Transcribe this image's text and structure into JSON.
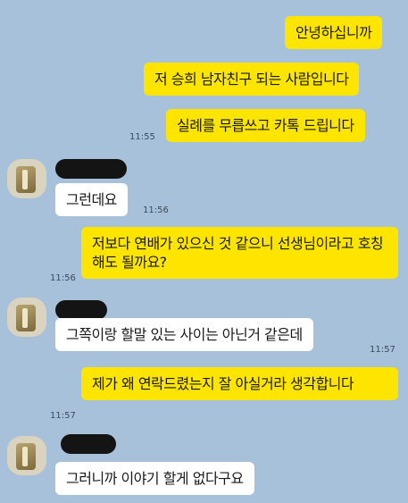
{
  "messages": [
    {
      "from": "me",
      "text": "안녕하십니까"
    },
    {
      "from": "me",
      "text": "저 승희 남자친구 되는 사람입니다"
    },
    {
      "from": "me",
      "text": "실례를 무릅쓰고 카톡 드립니다",
      "time": "11:55"
    },
    {
      "from": "other",
      "text": "그런데요",
      "time": "11:56"
    },
    {
      "from": "me",
      "text": "저보다 연배가 있으신 것 같으니 선생님이라고 호칭해도 될까요?",
      "time": "11:56"
    },
    {
      "from": "other",
      "text": "그쪽이랑 할말 있는 사이는 아닌거 같은데",
      "time": "11:57"
    },
    {
      "from": "me",
      "text": "제가 왜 연락드렸는지 잘 아실거라 생각합니다",
      "time": "11:57"
    },
    {
      "from": "other",
      "text": "그러니까 이야기 할게 없다구요"
    }
  ],
  "colors": {
    "background": "#a8c1da",
    "my_bubble": "#fee500",
    "other_bubble": "#ffffff",
    "redaction": "#141414"
  }
}
